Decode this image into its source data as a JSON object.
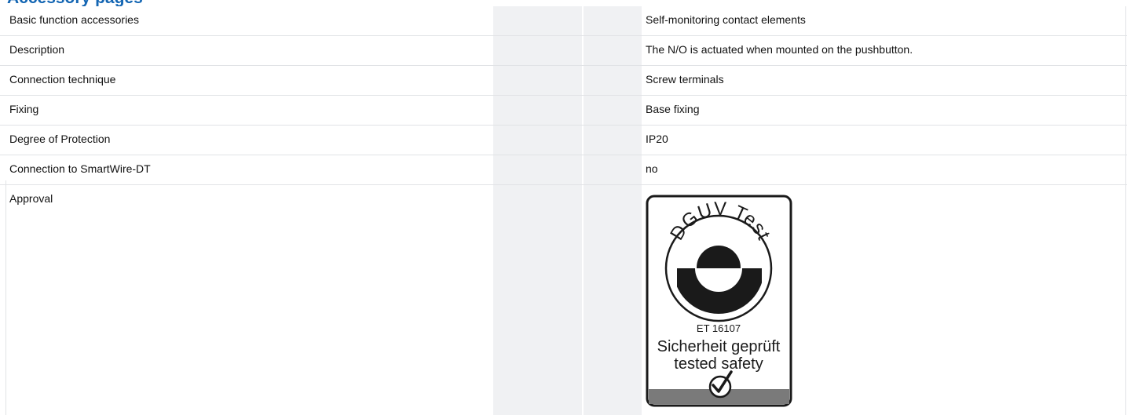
{
  "header": {
    "title_fragment": "Accessory pages"
  },
  "table": {
    "rows": [
      {
        "label": "Basic function accessories",
        "value": "Self-monitoring contact elements"
      },
      {
        "label": "Description",
        "value": "The N/O is actuated when mounted on the pushbutton."
      },
      {
        "label": "Connection technique",
        "value": "Screw terminals"
      },
      {
        "label": "Fixing",
        "value": "Base fixing"
      },
      {
        "label": "Degree of Protection",
        "value": "IP20"
      },
      {
        "label": "Connection to SmartWire-DT",
        "value": "no"
      }
    ],
    "approval": {
      "label": "Approval",
      "seal_title": "DGUV Test",
      "seal_number": "ET 16107",
      "seal_line1": "Sicherheit geprüft",
      "seal_line2": "tested safety"
    }
  }
}
